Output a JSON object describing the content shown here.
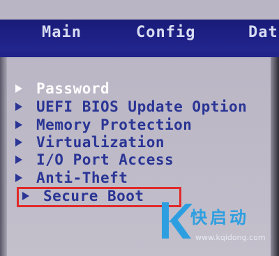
{
  "tabs": [
    {
      "label": "Main"
    },
    {
      "label": "Config"
    },
    {
      "label": "Dat"
    }
  ],
  "menu": {
    "items": [
      {
        "label": "Password",
        "selected": true
      },
      {
        "label": "UEFI BIOS Update Option"
      },
      {
        "label": "Memory Protection"
      },
      {
        "label": "Virtualization"
      },
      {
        "label": "I/O Port Access"
      },
      {
        "label": "Anti-Theft"
      },
      {
        "label": "Secure Boot",
        "highlighted": true
      }
    ]
  },
  "watermark": {
    "brand": "快启动",
    "url": "www.kqidong.com",
    "color": "#2d9fe0"
  },
  "colors": {
    "topbar": "#1e2086",
    "menu_text": "#2a3595",
    "selected_text": "#ffffff",
    "highlight_box": "#e02a2a"
  }
}
